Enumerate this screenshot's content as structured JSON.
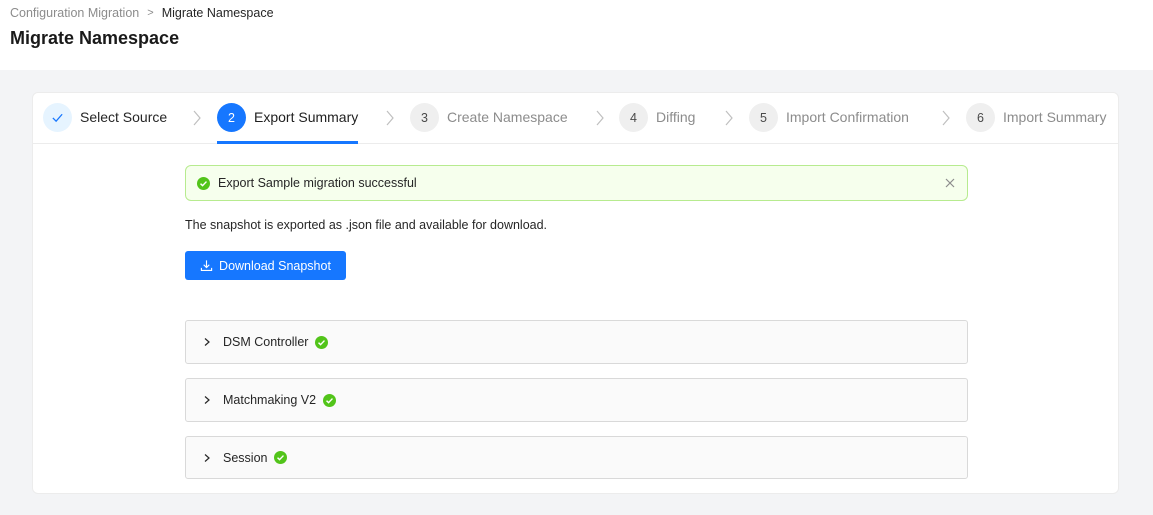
{
  "header": {
    "breadcrumb": [
      {
        "label": "Configuration Migration"
      },
      {
        "label": "Migrate Namespace"
      }
    ],
    "breadcrumb_separator": ">",
    "title": "Migrate Namespace"
  },
  "steps": [
    {
      "number": "1",
      "label": "Select Source",
      "status": "done",
      "icon": "check-icon"
    },
    {
      "number": "2",
      "label": "Export Summary",
      "status": "active"
    },
    {
      "number": "3",
      "label": "Create Namespace",
      "status": "pending"
    },
    {
      "number": "4",
      "label": "Diffing",
      "status": "pending"
    },
    {
      "number": "5",
      "label": "Import Confirmation",
      "status": "pending"
    },
    {
      "number": "6",
      "label": "Import Summary",
      "status": "pending"
    }
  ],
  "alert": {
    "type": "success",
    "message": "Export Sample migration successful",
    "icon": "check-circle-icon",
    "close_icon": "close-icon"
  },
  "description": "The snapshot is exported as .json file and available for download.",
  "download_button": {
    "label": "Download Snapshot",
    "icon": "download-icon"
  },
  "panels": [
    {
      "title": "DSM Controller",
      "status": "success"
    },
    {
      "title": "Matchmaking V2",
      "status": "success"
    },
    {
      "title": "Session",
      "status": "success"
    }
  ],
  "colors": {
    "primary": "#1677ff",
    "success": "#52c41a",
    "alert_bg": "#f6ffed",
    "alert_border": "#b7eb8f"
  }
}
